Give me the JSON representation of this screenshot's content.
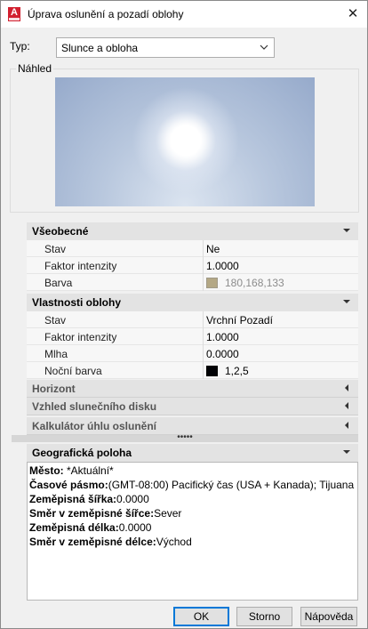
{
  "window": {
    "title": "Úprava oslunění a pozadí oblohy",
    "app_icon_letter": "A",
    "close_glyph": "✕"
  },
  "type_field": {
    "label": "Typ:",
    "value": "Slunce a obloha"
  },
  "preview": {
    "label": "Náhled"
  },
  "sections": {
    "general": {
      "title": "Všeobecné",
      "rows": [
        {
          "key": "Stav",
          "value": "Ne"
        },
        {
          "key": "Faktor intenzity",
          "value": "1.0000"
        },
        {
          "key": "Barva",
          "value": "180,168,133",
          "swatch": "#b4a885"
        }
      ]
    },
    "sky": {
      "title": "Vlastnosti oblohy",
      "rows": [
        {
          "key": "Stav",
          "value": "Vrchní Pozadí"
        },
        {
          "key": "Faktor intenzity",
          "value": "1.0000"
        },
        {
          "key": "Mlha",
          "value": "0.0000"
        },
        {
          "key": "Noční barva",
          "value": "1,2,5",
          "swatch": "#010205"
        }
      ]
    },
    "horizon": {
      "title": "Horizont"
    },
    "sun_disk": {
      "title": "Vzhled slunečního disku"
    },
    "calculator": {
      "title": "Kalkulátor úhlu oslunění"
    }
  },
  "splitter_glyph": "•••••",
  "geo": {
    "title": "Geografická poloha",
    "lines": [
      {
        "key": "Město:",
        "value": " *Aktuální*"
      },
      {
        "key": "Časové pásmo:",
        "value": "(GMT-08:00) Pacifický čas (USA + Kanada); Tijuana"
      },
      {
        "key": "Zeměpisná šířka:",
        "value": "0.0000"
      },
      {
        "key": "Směr v zeměpisné šířce:",
        "value": "Sever"
      },
      {
        "key": "Zeměpisná délka:",
        "value": "0.0000"
      },
      {
        "key": "Směr v zeměpisné délce:",
        "value": "Východ"
      }
    ]
  },
  "buttons": {
    "ok": "OK",
    "cancel": "Storno",
    "help": "Nápověda"
  },
  "icons": {
    "dropdown": "chevron-down-icon",
    "collapse": "triangle-down-icon",
    "expand": "triangle-left-icon"
  }
}
